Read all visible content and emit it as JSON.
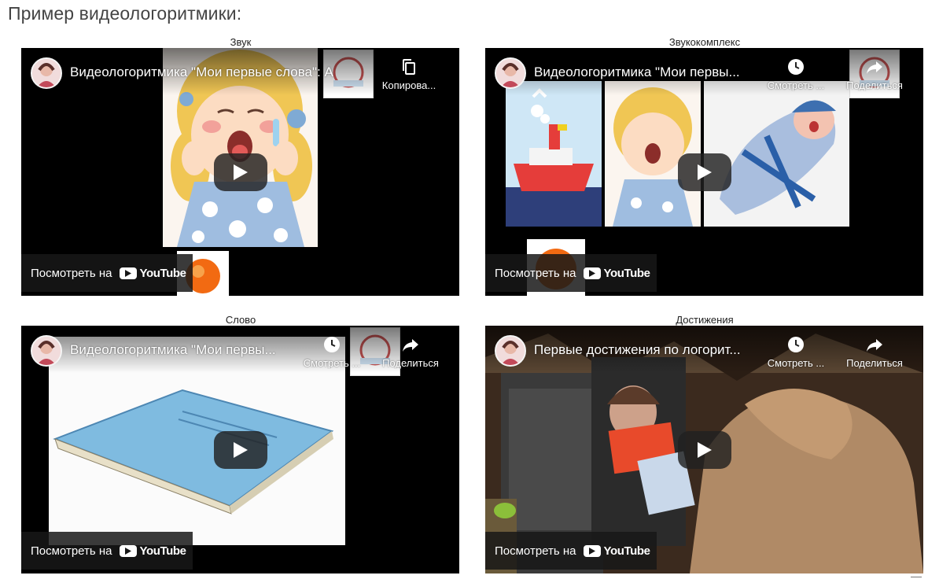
{
  "page": {
    "title": "Пример видеологоритмики:"
  },
  "videos": [
    {
      "caption": "Звук",
      "title": "Видеологоритмика \"Мои первые слова\": А",
      "actions": [
        {
          "icon": "copy-icon",
          "label": "Копирова..."
        }
      ],
      "watch_label": "Посмотреть на",
      "youtube_label": "YouTube"
    },
    {
      "caption": "Звукокомплекс",
      "title": "Видеологоритмика \"Мои первы...",
      "actions": [
        {
          "icon": "clock-icon",
          "label": "Смотреть ..."
        },
        {
          "icon": "share-icon",
          "label": "Поделиться"
        }
      ],
      "watch_label": "Посмотреть на",
      "youtube_label": "YouTube"
    },
    {
      "caption": "Слово",
      "title": "Видеологоритмика \"Мои первы...",
      "actions": [
        {
          "icon": "clock-icon",
          "label": "Смотреть ..."
        },
        {
          "icon": "share-icon",
          "label": "Поделиться"
        }
      ],
      "watch_label": "Посмотреть на",
      "youtube_label": "YouTube"
    },
    {
      "caption": "Достижения",
      "title": "Первые достижения по логорит...",
      "actions": [
        {
          "icon": "clock-icon",
          "label": "Смотреть ..."
        },
        {
          "icon": "share-icon",
          "label": "Поделиться"
        }
      ],
      "watch_label": "Посмотреть на",
      "youtube_label": "YouTube"
    }
  ],
  "colors": {
    "yt_red": "#ff0000",
    "overlay": "#171717",
    "page_bg": "#ffffff"
  }
}
